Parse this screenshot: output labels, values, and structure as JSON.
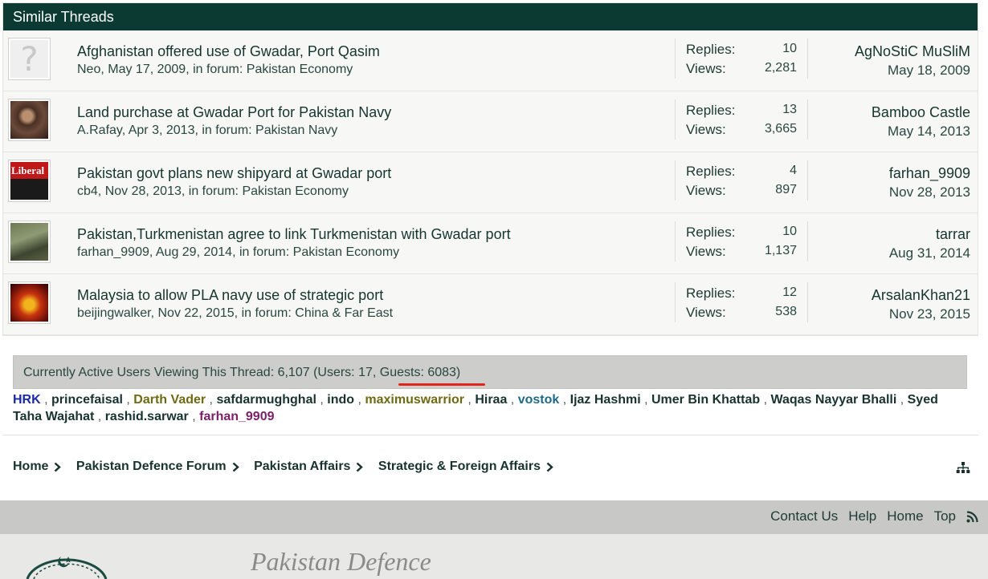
{
  "similar_threads": {
    "header": "Similar Threads",
    "replies_label": "Replies:",
    "views_label": "Views:",
    "threads": [
      {
        "title": "Afghanistan offered use of Gwadar, Port Qasim",
        "meta": "Neo, May 17, 2009, in forum: Pakistan Economy",
        "replies": "10",
        "views": "2,281",
        "last_user": "AgNoStiC MuSliM",
        "last_date": "May 18, 2009",
        "avatar_text": "?"
      },
      {
        "title": "Land purchase at Gwadar Port for Pakistan Navy",
        "meta": "A.Rafay, Apr 3, 2013, in forum: Pakistan Navy",
        "replies": "13",
        "views": "3,665",
        "last_user": "Bamboo Castle",
        "last_date": "May 14, 2013",
        "avatar_text": ""
      },
      {
        "title": "Pakistan govt plans new shipyard at Gwadar port",
        "meta": "cb4, Nov 28, 2013, in forum: Pakistan Economy",
        "replies": "4",
        "views": "897",
        "last_user": "farhan_9909",
        "last_date": "Nov 28, 2013",
        "avatar_text": "Liberal"
      },
      {
        "title": "Pakistan,Turkmenistan agree to link Turkmenistan with Gwadar port",
        "meta": "farhan_9909, Aug 29, 2014, in forum: Pakistan Economy",
        "replies": "10",
        "views": "1,137",
        "last_user": "tarrar",
        "last_date": "Aug 31, 2014",
        "avatar_text": ""
      },
      {
        "title": "Malaysia to allow PLA navy use of strategic port",
        "meta": "beijingwalker, Nov 22, 2015, in forum: China & Far East",
        "replies": "12",
        "views": "538",
        "last_user": "ArsalanKhan21",
        "last_date": "Nov 23, 2015",
        "avatar_text": ""
      }
    ]
  },
  "active_users": {
    "summary": "Currently Active Users Viewing This Thread: 6,107 (Users: 17, Guests: 6083)",
    "users": [
      {
        "name": "HRK",
        "style": "blue"
      },
      {
        "name": "princefaisal",
        "style": "default"
      },
      {
        "name": "Darth Vader",
        "style": "olive"
      },
      {
        "name": "safdarmughghal",
        "style": "default"
      },
      {
        "name": "indo",
        "style": "default"
      },
      {
        "name": "maximuswarrior",
        "style": "olive"
      },
      {
        "name": "Hiraa",
        "style": "default"
      },
      {
        "name": "vostok",
        "style": "teal"
      },
      {
        "name": "Ijaz Hashmi",
        "style": "default"
      },
      {
        "name": "Umer Bin Khattab",
        "style": "default"
      },
      {
        "name": "Waqas Nayyar Bhalli",
        "style": "default"
      },
      {
        "name": "Syed Taha Wajahat",
        "style": "default"
      },
      {
        "name": "rashid.sarwar",
        "style": "default"
      },
      {
        "name": "farhan_9909",
        "style": "purple"
      }
    ],
    "separator": ","
  },
  "breadcrumb": [
    "Home",
    "Pakistan Defence Forum",
    "Pakistan Affairs",
    "Strategic & Foreign Affairs"
  ],
  "footer": {
    "links": [
      "Contact Us",
      "Help",
      "Home",
      "Top"
    ],
    "brand": "Pakistan Defence"
  },
  "colors": {
    "header_bg": "#0b3a33",
    "highlight_underline": "#e0251b",
    "link_text": "#18332e"
  }
}
